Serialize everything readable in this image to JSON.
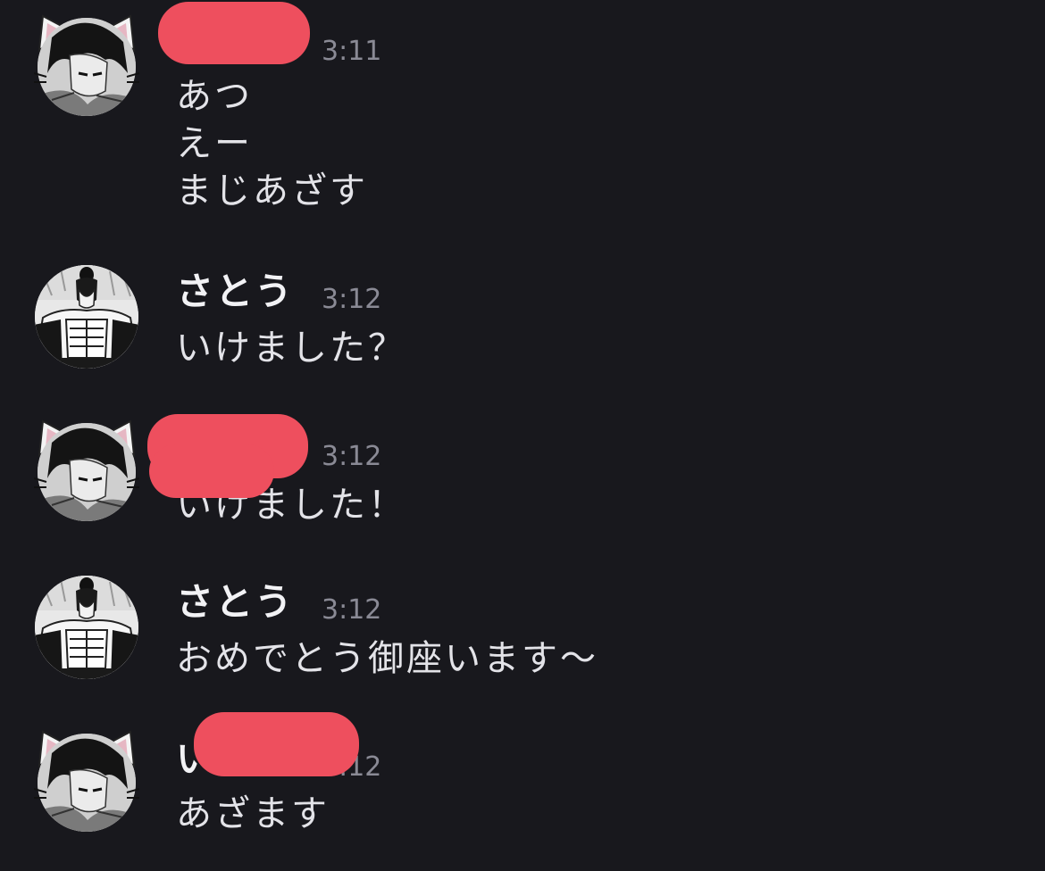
{
  "chat": {
    "messages": [
      {
        "sender": "",
        "time": "3:11",
        "avatar": "cat-ear-avatar",
        "lines": [
          "あつ",
          "えー",
          "まじあざす"
        ]
      },
      {
        "sender": "さとう",
        "time": "3:12",
        "avatar": "character-avatar",
        "lines": [
          "いけました？"
        ]
      },
      {
        "sender": "",
        "time": "3:12",
        "avatar": "cat-ear-avatar",
        "lines": [
          "いけました！"
        ]
      },
      {
        "sender": "さとう",
        "time": "3:12",
        "avatar": "character-avatar",
        "lines": [
          "おめでとう御座います〜"
        ]
      },
      {
        "sender": "い",
        "time": "3:12",
        "avatar": "cat-ear-avatar",
        "lines": [
          "あざます"
        ]
      }
    ],
    "redaction_color": "#ee4f5e"
  }
}
